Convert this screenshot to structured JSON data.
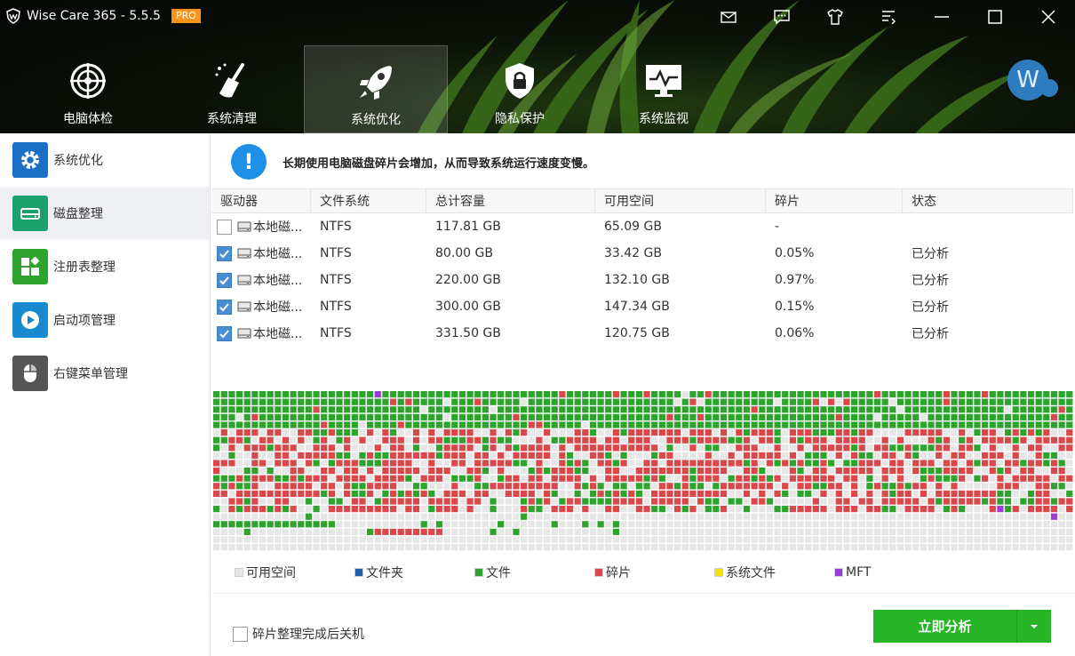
{
  "app": {
    "title": "Wise Care 365 - 5.5.5",
    "badge": "PRO"
  },
  "window_controls": [
    "mail-icon",
    "feedback-icon",
    "skin-icon",
    "menu-icon",
    "minimize-icon",
    "maximize-icon",
    "close-icon"
  ],
  "nav": [
    {
      "label": "电脑体检",
      "icon": "checkup-icon"
    },
    {
      "label": "系统清理",
      "icon": "broom-icon"
    },
    {
      "label": "系统优化",
      "icon": "rocket-icon",
      "active": true
    },
    {
      "label": "隐私保护",
      "icon": "privacy-icon"
    },
    {
      "label": "系统监视",
      "icon": "monitor-icon"
    }
  ],
  "user": {
    "avatar_letter": "W"
  },
  "sidebar": [
    {
      "label": "系统优化",
      "icon": "gear-icon",
      "color": "#1a6fc7"
    },
    {
      "label": "磁盘整理",
      "icon": "disk-icon",
      "color": "#1aa06d",
      "active": true
    },
    {
      "label": "注册表整理",
      "icon": "registry-icon",
      "color": "#2ea42e"
    },
    {
      "label": "启动项管理",
      "icon": "play-icon",
      "color": "#1a8ad0"
    },
    {
      "label": "右键菜单管理",
      "icon": "mouse-icon",
      "color": "#555555"
    }
  ],
  "info": {
    "text": "长期使用电脑磁盘碎片会增加，从而导致系统运行速度变慢。"
  },
  "table": {
    "headers": [
      "驱动器",
      "文件系统",
      "总计容量",
      "可用空间",
      "碎片",
      "状态"
    ],
    "rows": [
      {
        "checked": false,
        "drive": "本地磁...",
        "fs": "NTFS",
        "total": "117.81 GB",
        "free": "65.09 GB",
        "frag": "-",
        "status": ""
      },
      {
        "checked": true,
        "drive": "本地磁...",
        "fs": "NTFS",
        "total": "80.00 GB",
        "free": "33.42 GB",
        "frag": "0.05%",
        "status": "已分析"
      },
      {
        "checked": true,
        "drive": "本地磁...",
        "fs": "NTFS",
        "total": "220.00 GB",
        "free": "132.10 GB",
        "frag": "0.97%",
        "status": "已分析"
      },
      {
        "checked": true,
        "drive": "本地磁...",
        "fs": "NTFS",
        "total": "300.00 GB",
        "free": "147.34 GB",
        "frag": "0.15%",
        "status": "已分析"
      },
      {
        "checked": true,
        "drive": "本地磁...",
        "fs": "NTFS",
        "total": "331.50 GB",
        "free": "120.75 GB",
        "frag": "0.06%",
        "status": "已分析"
      }
    ]
  },
  "legend": [
    {
      "label": "可用空间",
      "color": "#e6e6e6"
    },
    {
      "label": "文件夹",
      "color": "#1f5faa"
    },
    {
      "label": "文件",
      "color": "#2ea42e"
    },
    {
      "label": "碎片",
      "color": "#d9484a"
    },
    {
      "label": "系统文件",
      "color": "#f2e20a"
    },
    {
      "label": "MFT",
      "color": "#9b3bd6"
    }
  ],
  "options": {
    "shutdown_label": "碎片整理完成后关机"
  },
  "actions": {
    "analyze_label": "立即分析"
  },
  "colors": {
    "accent": "#25b525",
    "info": "#1e90e8"
  }
}
